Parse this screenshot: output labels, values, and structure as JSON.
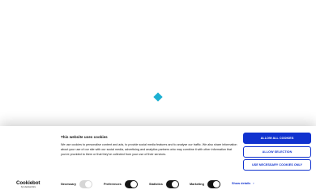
{
  "banner": {
    "title": "This website uses cookies",
    "text": "We use cookies to personalise content and ads, to provide social media features and to analyse our traffic. We also share information about your use of our site with our social media, advertising and analytics partners who may combine it with other information that you've provided to them or that they've collected from your use of their services."
  },
  "buttons": {
    "allow_all": "ALLOW ALL COOKIES",
    "allow_selection": "ALLOW SELECTION",
    "necessary_only": "USE NECESSARY COOKIES ONLY"
  },
  "logo": {
    "name": "Cookiebot",
    "sub": "by Usercentrics"
  },
  "toggles": [
    {
      "label": "Necessary",
      "checked": true,
      "disabled": true
    },
    {
      "label": "Preferences",
      "checked": true,
      "disabled": false
    },
    {
      "label": "Statistics",
      "checked": true,
      "disabled": false
    },
    {
      "label": "Marketing",
      "checked": true,
      "disabled": false
    }
  ],
  "details": {
    "label": "Show details",
    "icon": "chevron-right-icon"
  },
  "colors": {
    "accent": "#1032cf",
    "loader": "#1cb0d2",
    "text": "#141414"
  }
}
